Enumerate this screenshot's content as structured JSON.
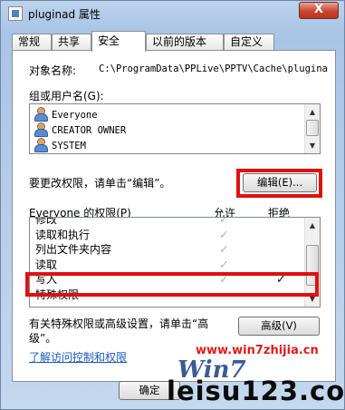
{
  "window": {
    "title": "pluginad 属性",
    "close_glyph": "X"
  },
  "tabs": [
    "常规",
    "共享",
    "安全",
    "以前的版本",
    "自定义"
  ],
  "security": {
    "object_label": "对象名称:",
    "object_path": "C:\\ProgramData\\PPLive\\PPTV\\Cache\\plugina",
    "group_label": "组或用户名(G):",
    "users": [
      "Everyone",
      "CREATOR OWNER",
      "SYSTEM"
    ],
    "edit_hint": "要更改权限，请单击“编辑”。",
    "edit_button": "编辑(E)...",
    "perm_header_label": "Everyone 的权限(P)",
    "allow_header": "允许",
    "deny_header": "拒绝",
    "permissions": [
      {
        "name": "修改",
        "allow": true,
        "deny": false
      },
      {
        "name": "读取和执行",
        "allow": true,
        "deny": false
      },
      {
        "name": "列出文件夹内容",
        "allow": true,
        "deny": false
      },
      {
        "name": "读取",
        "allow": true,
        "deny": false
      },
      {
        "name": "写入",
        "allow": true,
        "deny": true
      },
      {
        "name": "特殊权限",
        "allow": false,
        "deny": false
      }
    ],
    "check_glyph": "✓",
    "special_hint_line1": "有关特殊权限或高级设置，请单击“高",
    "special_hint_line2": "级”。",
    "advanced_button": "高级(V)",
    "learn_link": "了解访问控制和权限"
  },
  "footer": {
    "ok_button": "确定"
  },
  "watermark": {
    "url": "www.win7zhijia.cn",
    "logo": "Win7",
    "site": "leisu123.com"
  },
  "colors": {
    "highlight_box": "#e01010",
    "link": "#1a5bb8"
  }
}
